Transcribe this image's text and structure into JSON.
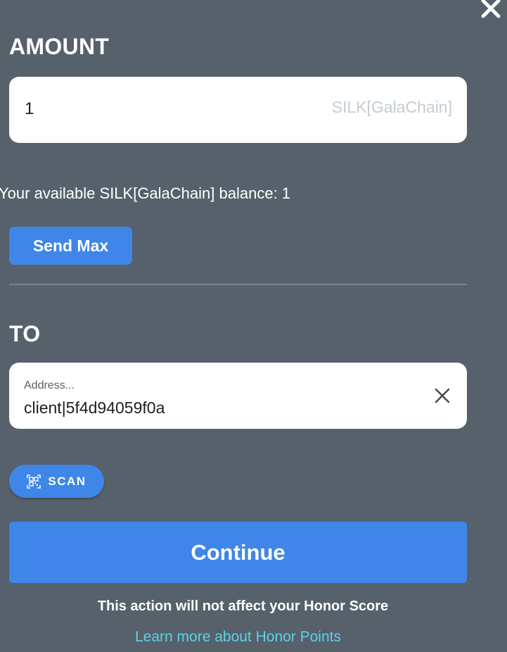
{
  "header": {
    "close_icon": "close-icon"
  },
  "amount": {
    "title": "AMOUNT",
    "value": "1",
    "unit": "SILK[GalaChain]",
    "balance_text": "Your available SILK[GalaChain] balance: 1",
    "send_max_label": "Send Max"
  },
  "recipient": {
    "title": "TO",
    "address_label": "Address...",
    "address_value": "client|5f4d94059f0a",
    "clear_icon": "close-icon",
    "scan_label": "SCAN",
    "scan_icon": "qr-code-icon"
  },
  "footer": {
    "continue_label": "Continue",
    "honor_note": "This action will not affect your Honor Score",
    "learn_more_label": "Learn more about Honor Points"
  },
  "colors": {
    "background": "#56616b",
    "accent": "#3f86e8",
    "link": "#5fd0e8",
    "unit_text": "#c4ccd3"
  }
}
